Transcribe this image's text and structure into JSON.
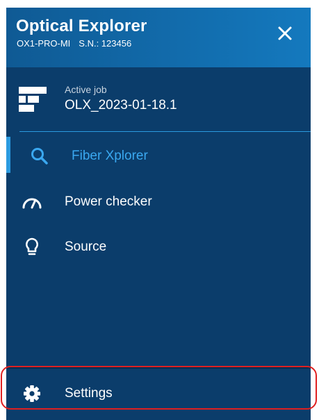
{
  "header": {
    "title": "Optical Explorer",
    "model": "OX1-PRO-MI",
    "serial": "S.N.: 123456",
    "close_icon": "close-icon"
  },
  "active_job": {
    "caption": "Active job",
    "name": "OLX_2023-01-18.1",
    "icon": "job-list-icon"
  },
  "nav": {
    "items": [
      {
        "label": "Fiber Xplorer",
        "icon": "search-icon",
        "active": true
      },
      {
        "label": "Power checker",
        "icon": "gauge-icon",
        "active": false
      },
      {
        "label": "Source",
        "icon": "lightbulb-icon",
        "active": false
      }
    ],
    "settings": {
      "label": "Settings",
      "icon": "gear-icon"
    }
  },
  "colors": {
    "panel_background": "#0b3d6b",
    "header_gradient_start": "#0f5a94",
    "header_gradient_end": "#1479be",
    "accent": "#2b9be0",
    "active_label": "#3aa8f0",
    "highlight_outline": "#e02020"
  }
}
